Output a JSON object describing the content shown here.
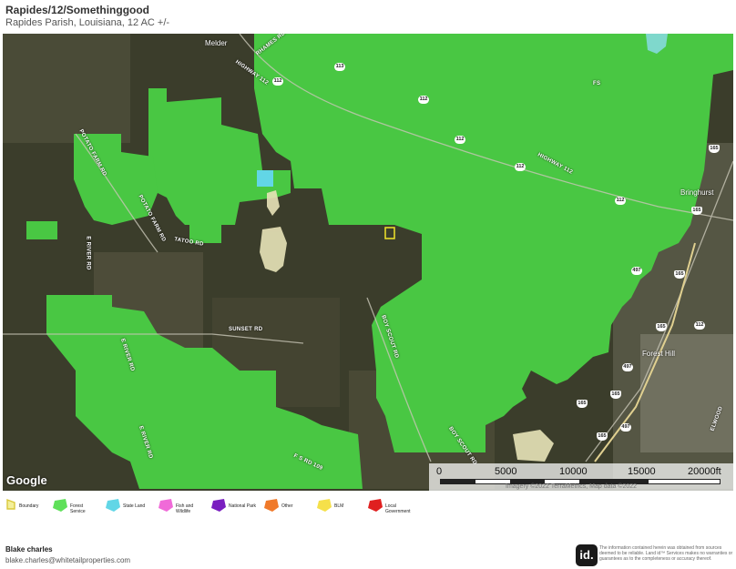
{
  "header": {
    "title": "Rapides/12/Somethinggood",
    "subtitle": "Rapides Parish, Louisiana, 12 AC +/-"
  },
  "map": {
    "provider": "Google",
    "attribution": "Imagery ©2022 TerraMetrics, Map data ©2022",
    "towns": [
      "Melder",
      "Bringhurst",
      "Forest Hill"
    ],
    "roads": [
      "RHAMES RD",
      "HIGHWAY 112",
      "POTATO FARM RD",
      "POTATO FARM RD",
      "TATOO RD",
      "E RIVER RD",
      "E RIVER RD",
      "E RIVER RD",
      "SUNSET RD",
      "BOY SCOUT RD",
      "BOY SCOUT RD",
      "HIGHWAY 112",
      "FS",
      "F S RD 109",
      "ELWOOD"
    ],
    "shields": [
      "113",
      "112",
      "112",
      "112",
      "112",
      "112",
      "165",
      "165",
      "165",
      "497",
      "165",
      "112",
      "497",
      "165",
      "165",
      "497",
      "165"
    ],
    "scale": {
      "ticks": [
        "0",
        "5000",
        "10000",
        "15000",
        "20000ft"
      ]
    }
  },
  "legend": [
    {
      "label": "Boundary",
      "color": "#d9c83a",
      "icon": "boundary-icon"
    },
    {
      "label": "Forest Service",
      "color": "#5fe05a",
      "icon": "forest-service-icon"
    },
    {
      "label": "State Land",
      "color": "#62d6e6",
      "icon": "state-land-icon"
    },
    {
      "label": "Fish and Wildlife",
      "color": "#f06ad8",
      "icon": "fish-wildlife-icon"
    },
    {
      "label": "National Park",
      "color": "#7a1fc0",
      "icon": "national-park-icon"
    },
    {
      "label": "Other",
      "color": "#f07a2a",
      "icon": "other-icon"
    },
    {
      "label": "BLM",
      "color": "#f5e04a",
      "icon": "blm-icon"
    },
    {
      "label": "Local Government",
      "color": "#e02020",
      "icon": "local-government-icon"
    }
  ],
  "footer": {
    "owner": "Blake charles",
    "email": "blake.charles@whitetailproperties.com",
    "logo_text": "id.",
    "disclaimer": "The information contained herein was obtained from sources deemed to be reliable. Land id™ Services makes no warranties or guarantees as to the completeness or accuracy thereof."
  }
}
